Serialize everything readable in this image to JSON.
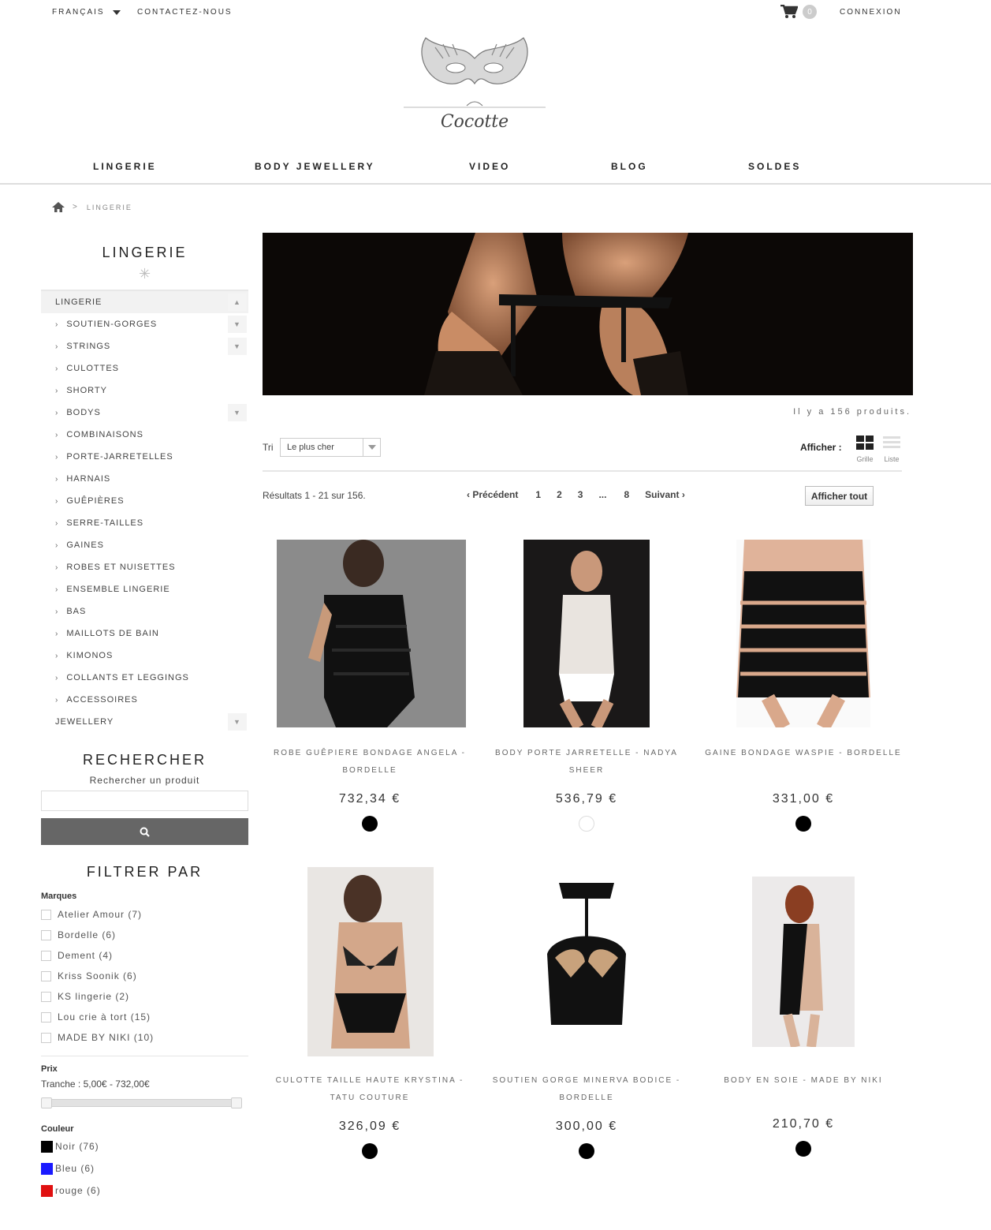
{
  "topbar": {
    "language": "FRANÇAIS",
    "contact": "CONTACTEZ-NOUS",
    "cart_count": "0",
    "login": "CONNEXION"
  },
  "logo": {
    "text": "Cocotte"
  },
  "nav": [
    "LINGERIE",
    "BODY JEWELLERY",
    "VIDEO",
    "BLOG",
    "SOLDES"
  ],
  "breadcrumb": {
    "current": "LINGERIE"
  },
  "sidebar": {
    "title": "LINGERIE",
    "top_category": "LINGERIE",
    "subcategories": [
      "SOUTIEN-GORGES",
      "STRINGS",
      "CULOTTES",
      "SHORTY",
      "BODYS",
      "COMBINAISONS",
      "PORTE-JARRETELLES",
      "HARNAIS",
      "GUÊPIÈRES",
      "SERRE-TAILLES",
      "GAINES",
      "ROBES ET NUISETTES",
      "ENSEMBLE LINGERIE",
      "BAS",
      "MAILLOTS DE BAIN",
      "KIMONOS",
      "COLLANTS ET LEGGINGS",
      "ACCESSOIRES"
    ],
    "second_category": "JEWELLERY",
    "search_title": "RECHERCHER",
    "search_subtitle": "Rechercher un produit",
    "filter_title": "FILTRER PAR",
    "brands_label": "Marques",
    "brands": [
      "Atelier Amour (7)",
      "Bordelle (6)",
      "Dement (4)",
      "Kriss Soonik (6)",
      "KS lingerie (2)",
      "Lou crie à tort (15)",
      "MADE BY NIKI (10)"
    ],
    "price_label": "Prix",
    "price_range": "Tranche : 5,00€ - 732,00€",
    "color_label": "Couleur",
    "colors": [
      {
        "label": "Noir (76)",
        "hex": "#000000"
      },
      {
        "label": "Bleu (6)",
        "hex": "#1a1aff"
      },
      {
        "label": "rouge (6)",
        "hex": "#e01010"
      }
    ]
  },
  "listing": {
    "product_count": "Il y a 156 produits.",
    "sort_label": "Tri",
    "sort_value": "Le plus cher",
    "show_label": "Afficher :",
    "view_grid": "Grille",
    "view_list": "Liste",
    "results": "Résultats 1 - 21 sur 156.",
    "prev": "Précédent",
    "pages": [
      "1",
      "2",
      "3",
      "...",
      "8"
    ],
    "next": "Suivant",
    "show_all": "Afficher tout"
  },
  "products": [
    {
      "name": "ROBE GUÊPIERE BONDAGE ANGELA - BORDELLE",
      "price": "732,34 €",
      "color": "#000000"
    },
    {
      "name": "BODY PORTE JARRETELLE - NADYA SHEER",
      "price": "536,79 €",
      "color": "#ffffff"
    },
    {
      "name": "GAINE BONDAGE WASPIE - BORDELLE",
      "price": "331,00 €",
      "color": "#000000"
    },
    {
      "name": "CULOTTE TAILLE HAUTE KRYSTINA - TATU COUTURE",
      "price": "326,09 €",
      "color": "#000000"
    },
    {
      "name": "SOUTIEN GORGE MINERVA BODICE - BORDELLE",
      "price": "300,00 €",
      "color": "#000000"
    },
    {
      "name": "BODY EN SOIE - MADE BY NIKI",
      "price": "210,70 €",
      "color": "#000000"
    }
  ]
}
